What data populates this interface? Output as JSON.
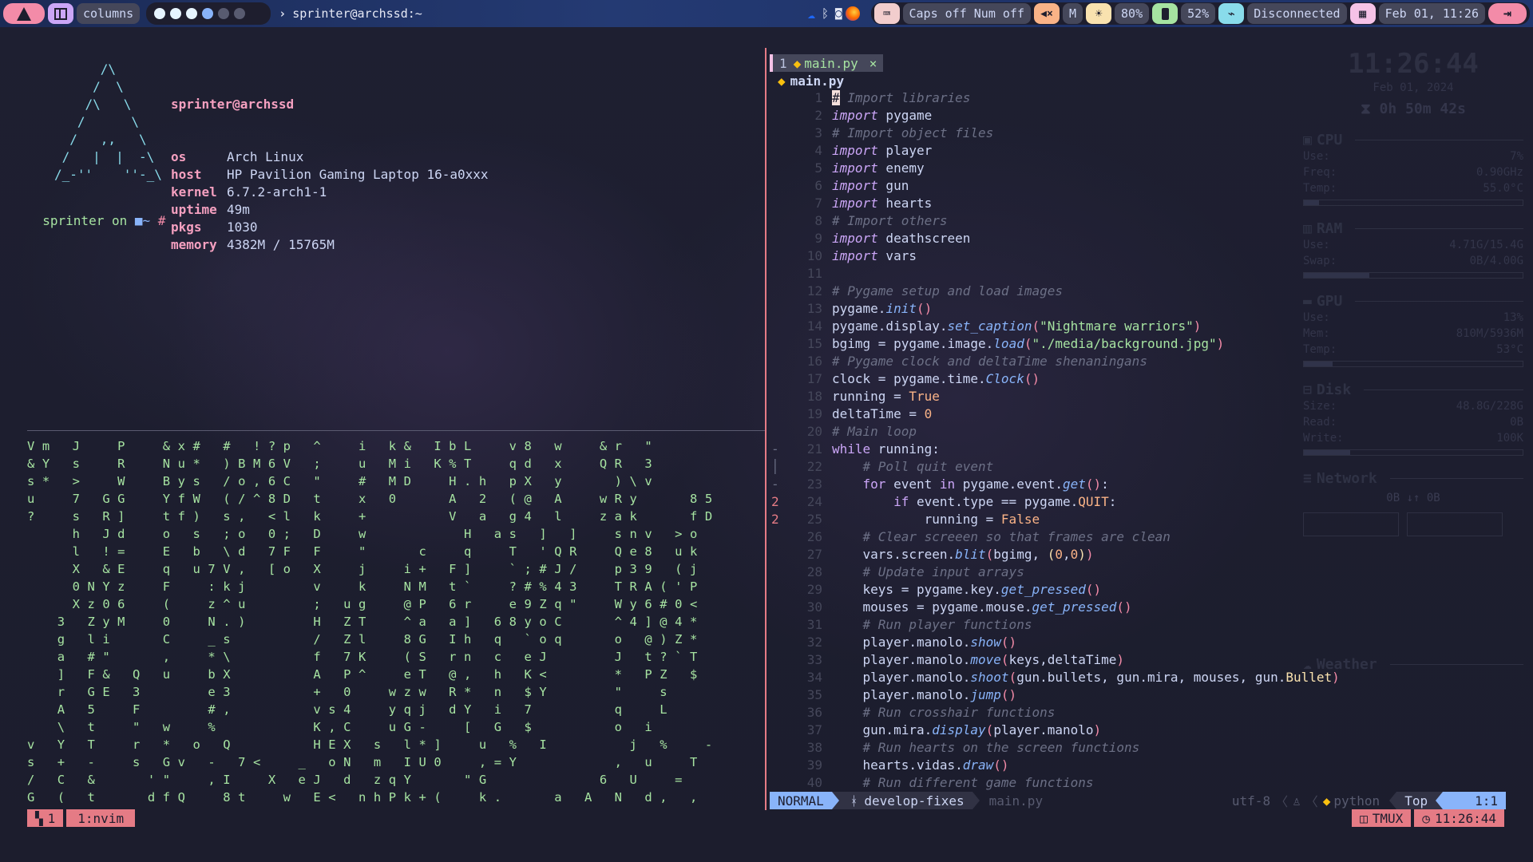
{
  "topbar": {
    "arch_logo": "arch-icon",
    "layout_label": "columns",
    "workspaces": [
      {
        "state": "active"
      },
      {
        "state": "active"
      },
      {
        "state": "active"
      },
      {
        "state": "focused"
      },
      {
        "state": "empty"
      },
      {
        "state": "empty"
      }
    ],
    "window_title": "sprinter@archssd:~",
    "tray": [
      "onedrive-icon",
      "bluetooth-icon",
      "discord-icon",
      "firefox-icon"
    ],
    "keyboard_status": "Caps off Num off",
    "volume_label": "M",
    "brightness": "80%",
    "battery": "52%",
    "network": "Disconnected",
    "datetime": "Feb 01, 11:26",
    "colors": {
      "accent_pink": "#f38ba8",
      "accent_purple": "#cba6f7",
      "kbd": "#f2cdcd",
      "vol": "#fab387",
      "bright": "#f9e2af",
      "bat": "#a6e3a1",
      "net": "#89dceb",
      "cal": "#f5c2e7"
    }
  },
  "fetch": {
    "ascii": [
      "      /\\",
      "     /  \\",
      "    /\\   \\",
      "   /      \\",
      "  /   ,,   \\",
      " /   |  |  -\\",
      "/_-''    ''-_\\"
    ],
    "user_host": "sprinter@archssd",
    "rows": [
      {
        "key": "os",
        "value": "Arch Linux"
      },
      {
        "key": "host",
        "value": "HP Pavilion Gaming Laptop 16-a0xxx"
      },
      {
        "key": "kernel",
        "value": "6.7.2-arch1-1"
      },
      {
        "key": "uptime",
        "value": "49m"
      },
      {
        "key": "pkgs",
        "value": "1030"
      },
      {
        "key": "memory",
        "value": "4382M / 15765M"
      }
    ],
    "prompt_user": "sprinter",
    "prompt_on": " on ",
    "prompt_dir": "~",
    "prompt_symbol": "#"
  },
  "matrix": [
    "V m   J     P     & x #   #   ! ? p   ^     i   k &   I b L     v 8   w     & r   \"",
    "& Y   s     R     N u *   ) B M 6 V   ;     u   M i   K % T     q d   x     Q R   3",
    "s *   >     W     B y s   / o , 6 C   \"     #   M D     H . h   p X   y       ) \\ v",
    "u     7   G G     Y f W   ( / ^ 8 D   t     x   0       A   2   ( @   A     w R y       8 5",
    "?     s   R ]     t f )   s ,   < l   k     +           V   a   g 4   l     z a k       f D",
    "      h   J d     o   s   ; o   0 ;   D     w             H   a s   ]   ]     s n v   > o",
    "      l   ! =     E   b   \\ d   7 F   F     \"       c     q     T   ' Q R     Q e 8   u k",
    "      X   & E     q   u 7 V ,   [ o   X     j     i +   F ]     ` ; # J /     p 3 9   ( j",
    "      0 N Y z     F     : k j         v     k     N M   t `     ? # % 4 3     T R A ( ' P",
    "      X z 0 6     (     z ^ u         ;   u g     @ P   6 r     e 9 Z q \"     W y 6 # 0 <",
    "    3   Z y M     0     N . )         H   Z T     ^ a   a ]   6 8 y o C       ^ 4 ] @ 4 *",
    "    g   l i       C     _ s           /   Z l     8 G   I h   q   ` o q       o   @ ) Z *",
    "    a   # \"       ,     * \\           f   7 K     ( S   r n   c   e J         J   t ? ` T",
    "    ]   F &   Q   u     b X           A   P ^     e T   @ ,   h   K <         *   P Z   $",
    "    r   G E   3         e 3           +   0     w z w   R *   n   $ Y         \"     s",
    "    A   5     F         # ,           v s 4     y q j   d Y   i   7           q     L",
    "    \\   t     \"   w     %             K , C     u G -     [   G   $           o   i",
    "v   Y   T     r   *   o   Q           H E X   s   l * ]     u   %   I           j   %     -",
    "s   +   -     s   G v   -   7 <     _   o N   m   I U 0     , = Y             ,   u     T",
    "/   C   &       ' \"     , I     X   e J   d   z q Y       \" G               6   U     =",
    "G   (   t       d f Q     8 t     w   E <   n h P k + (     k .       a   A   N   d ,   ,"
  ],
  "nvim": {
    "buffer_index": "1",
    "buffer_name": "main.py",
    "buffer_close": "×",
    "winbar_file": "main.py",
    "lines": [
      {
        "n": "1",
        "sign": "",
        "tokens": [
          [
            "cur",
            "#"
          ],
          [
            "cm",
            " Import libraries"
          ]
        ]
      },
      {
        "n": "2",
        "sign": "",
        "tokens": [
          [
            "kw",
            "import"
          ],
          [
            "txt",
            " pygame"
          ]
        ]
      },
      {
        "n": "3",
        "sign": "",
        "tokens": [
          [
            "cm",
            "# Import object files"
          ]
        ]
      },
      {
        "n": "4",
        "sign": "",
        "tokens": [
          [
            "kw",
            "import"
          ],
          [
            "txt",
            " player"
          ]
        ]
      },
      {
        "n": "5",
        "sign": "",
        "tokens": [
          [
            "kw",
            "import"
          ],
          [
            "txt",
            " enemy"
          ]
        ]
      },
      {
        "n": "6",
        "sign": "",
        "tokens": [
          [
            "kw",
            "import"
          ],
          [
            "txt",
            " gun"
          ]
        ]
      },
      {
        "n": "7",
        "sign": "",
        "tokens": [
          [
            "kw",
            "import"
          ],
          [
            "txt",
            " hearts"
          ]
        ]
      },
      {
        "n": "8",
        "sign": "",
        "tokens": [
          [
            "cm",
            "# Import others"
          ]
        ]
      },
      {
        "n": "9",
        "sign": "",
        "tokens": [
          [
            "kw",
            "import"
          ],
          [
            "txt",
            " deathscreen"
          ]
        ]
      },
      {
        "n": "10",
        "sign": "",
        "tokens": [
          [
            "kw",
            "import"
          ],
          [
            "txt",
            " vars"
          ]
        ]
      },
      {
        "n": "11",
        "sign": "",
        "tokens": []
      },
      {
        "n": "12",
        "sign": "",
        "tokens": [
          [
            "cm",
            "# Pygame setup and load images"
          ]
        ]
      },
      {
        "n": "13",
        "sign": "",
        "tokens": [
          [
            "txt",
            "pygame."
          ],
          [
            "fn",
            "init"
          ],
          [
            "pn",
            "()"
          ]
        ]
      },
      {
        "n": "14",
        "sign": "",
        "tokens": [
          [
            "txt",
            "pygame.display."
          ],
          [
            "fn",
            "set_caption"
          ],
          [
            "pn",
            "("
          ],
          [
            "st",
            "\"Nightmare warriors\""
          ],
          [
            "pn",
            ")"
          ]
        ]
      },
      {
        "n": "15",
        "sign": "",
        "tokens": [
          [
            "txt",
            "bgimg = pygame.image."
          ],
          [
            "fn",
            "load"
          ],
          [
            "pn",
            "("
          ],
          [
            "st",
            "\"./media/background.jpg\""
          ],
          [
            "pn",
            ")"
          ]
        ]
      },
      {
        "n": "16",
        "sign": "",
        "tokens": [
          [
            "cm",
            "# Pygame clock and deltaTime shenaningans"
          ]
        ]
      },
      {
        "n": "17",
        "sign": "",
        "tokens": [
          [
            "txt",
            "clock = pygame.time."
          ],
          [
            "fn",
            "Clock"
          ],
          [
            "pn",
            "()"
          ]
        ]
      },
      {
        "n": "18",
        "sign": "",
        "tokens": [
          [
            "txt",
            "running = "
          ],
          [
            "bo",
            "True"
          ]
        ]
      },
      {
        "n": "19",
        "sign": "",
        "tokens": [
          [
            "txt",
            "deltaTime = "
          ],
          [
            "nu",
            "0"
          ]
        ]
      },
      {
        "n": "20",
        "sign": "",
        "tokens": [
          [
            "cm",
            "# Main loop"
          ]
        ]
      },
      {
        "n": "21",
        "sign": "-",
        "tokens": [
          [
            "kw2",
            "while"
          ],
          [
            "txt",
            " running:"
          ]
        ]
      },
      {
        "n": "22",
        "sign": "│",
        "tokens": [
          [
            "txt",
            "    "
          ],
          [
            "cm",
            "# Poll quit event"
          ]
        ]
      },
      {
        "n": "23",
        "sign": "-",
        "tokens": [
          [
            "txt",
            "    "
          ],
          [
            "kw2",
            "for"
          ],
          [
            "txt",
            " event "
          ],
          [
            "kw2",
            "in"
          ],
          [
            "txt",
            " pygame.event."
          ],
          [
            "fn",
            "get"
          ],
          [
            "pn",
            "()"
          ],
          [
            "txt",
            ":"
          ]
        ]
      },
      {
        "n": "24",
        "sign": "2",
        "tokens": [
          [
            "txt",
            "        "
          ],
          [
            "kw2",
            "if"
          ],
          [
            "txt",
            " event.type == pygame."
          ],
          [
            "bo",
            "QUIT"
          ],
          [
            "txt",
            ":"
          ]
        ]
      },
      {
        "n": "25",
        "sign": "2",
        "tokens": [
          [
            "txt",
            "            running = "
          ],
          [
            "bo",
            "False"
          ]
        ]
      },
      {
        "n": "26",
        "sign": "",
        "tokens": [
          [
            "txt",
            "    "
          ],
          [
            "cm",
            "# Clear screeen so that frames are clean"
          ]
        ]
      },
      {
        "n": "27",
        "sign": "",
        "tokens": [
          [
            "txt",
            "    vars.screen."
          ],
          [
            "fn",
            "blit"
          ],
          [
            "pn",
            "("
          ],
          [
            "txt",
            "bgimg, "
          ],
          [
            "cls",
            "("
          ],
          [
            "nu",
            "0"
          ],
          [
            "txt",
            ","
          ],
          [
            "nu",
            "0"
          ],
          [
            "cls",
            ")"
          ],
          [
            "pn",
            ")"
          ]
        ]
      },
      {
        "n": "28",
        "sign": "",
        "tokens": [
          [
            "txt",
            "    "
          ],
          [
            "cm",
            "# Update input arrays"
          ]
        ]
      },
      {
        "n": "29",
        "sign": "",
        "tokens": [
          [
            "txt",
            "    keys = pygame.key."
          ],
          [
            "fn",
            "get_pressed"
          ],
          [
            "pn",
            "()"
          ]
        ]
      },
      {
        "n": "30",
        "sign": "",
        "tokens": [
          [
            "txt",
            "    mouses = pygame.mouse."
          ],
          [
            "fn",
            "get_pressed"
          ],
          [
            "pn",
            "()"
          ]
        ]
      },
      {
        "n": "31",
        "sign": "",
        "tokens": [
          [
            "txt",
            "    "
          ],
          [
            "cm",
            "# Run player functions"
          ]
        ]
      },
      {
        "n": "32",
        "sign": "",
        "tokens": [
          [
            "txt",
            "    player.manolo."
          ],
          [
            "fn",
            "show"
          ],
          [
            "pn",
            "()"
          ]
        ]
      },
      {
        "n": "33",
        "sign": "",
        "tokens": [
          [
            "txt",
            "    player.manolo."
          ],
          [
            "fn",
            "move"
          ],
          [
            "pn",
            "("
          ],
          [
            "txt",
            "keys,deltaTime"
          ],
          [
            "pn",
            ")"
          ]
        ]
      },
      {
        "n": "34",
        "sign": "",
        "tokens": [
          [
            "txt",
            "    player.manolo."
          ],
          [
            "fn",
            "shoot"
          ],
          [
            "pn",
            "("
          ],
          [
            "txt",
            "gun.bullets, gun.mira, mouses, gun."
          ],
          [
            "cls",
            "Bullet"
          ],
          [
            "pn",
            ")"
          ]
        ]
      },
      {
        "n": "35",
        "sign": "",
        "tokens": [
          [
            "txt",
            "    player.manolo."
          ],
          [
            "fn",
            "jump"
          ],
          [
            "pn",
            "()"
          ]
        ]
      },
      {
        "n": "36",
        "sign": "",
        "tokens": [
          [
            "txt",
            "    "
          ],
          [
            "cm",
            "# Run crosshair functions"
          ]
        ]
      },
      {
        "n": "37",
        "sign": "",
        "tokens": [
          [
            "txt",
            "    gun.mira."
          ],
          [
            "fn",
            "display"
          ],
          [
            "pn",
            "("
          ],
          [
            "txt",
            "player.manolo"
          ],
          [
            "pn",
            ")"
          ]
        ]
      },
      {
        "n": "38",
        "sign": "",
        "tokens": [
          [
            "txt",
            "    "
          ],
          [
            "cm",
            "# Run hearts on the screen functions"
          ]
        ]
      },
      {
        "n": "39",
        "sign": "",
        "tokens": [
          [
            "txt",
            "    hearts.vidas."
          ],
          [
            "fn",
            "draw"
          ],
          [
            "pn",
            "()"
          ]
        ]
      },
      {
        "n": "40",
        "sign": "",
        "tokens": [
          [
            "txt",
            "    "
          ],
          [
            "cm",
            "# Run different game functions"
          ]
        ]
      }
    ],
    "status": {
      "mode": "NORMAL",
      "branch": "develop-fixes",
      "file": "main.py",
      "encoding": "utf-8",
      "filetype": "python",
      "position": "Top",
      "cursor": "1:1"
    }
  },
  "tmux": {
    "session": "1",
    "window": "1:nvim",
    "right_label": "TMUX",
    "clock": "11:26:44"
  },
  "conky": {
    "time": "11:26:44",
    "date": "Feb 01, 2024",
    "uptime": "0h 50m 42s",
    "cpu": {
      "title": "CPU",
      "use": "7%",
      "freq": "0.90GHz",
      "temp": "55.0°C",
      "bar": 0.07
    },
    "ram": {
      "title": "RAM",
      "use": "4.71G/15.4G",
      "swap": "0B/4.00G",
      "bar": 0.3
    },
    "gpu": {
      "title": "GPU",
      "use": "13%",
      "mem": "810M/5936M",
      "temp": "53°C",
      "bar": 0.13
    },
    "disk": {
      "title": "Disk",
      "size": "48.8G/228G",
      "read": "0B",
      "write": "100K",
      "bar": 0.21
    },
    "network": {
      "title": "Network",
      "speed": "0B ↓↑ 0B"
    },
    "weather": {
      "title": "Weather"
    },
    "labels": {
      "use": "Use:",
      "freq": "Freq:",
      "temp": "Temp:",
      "swap": "Swap:",
      "mem": "Mem:",
      "size": "Size:",
      "read": "Read:",
      "write": "Write:"
    }
  }
}
